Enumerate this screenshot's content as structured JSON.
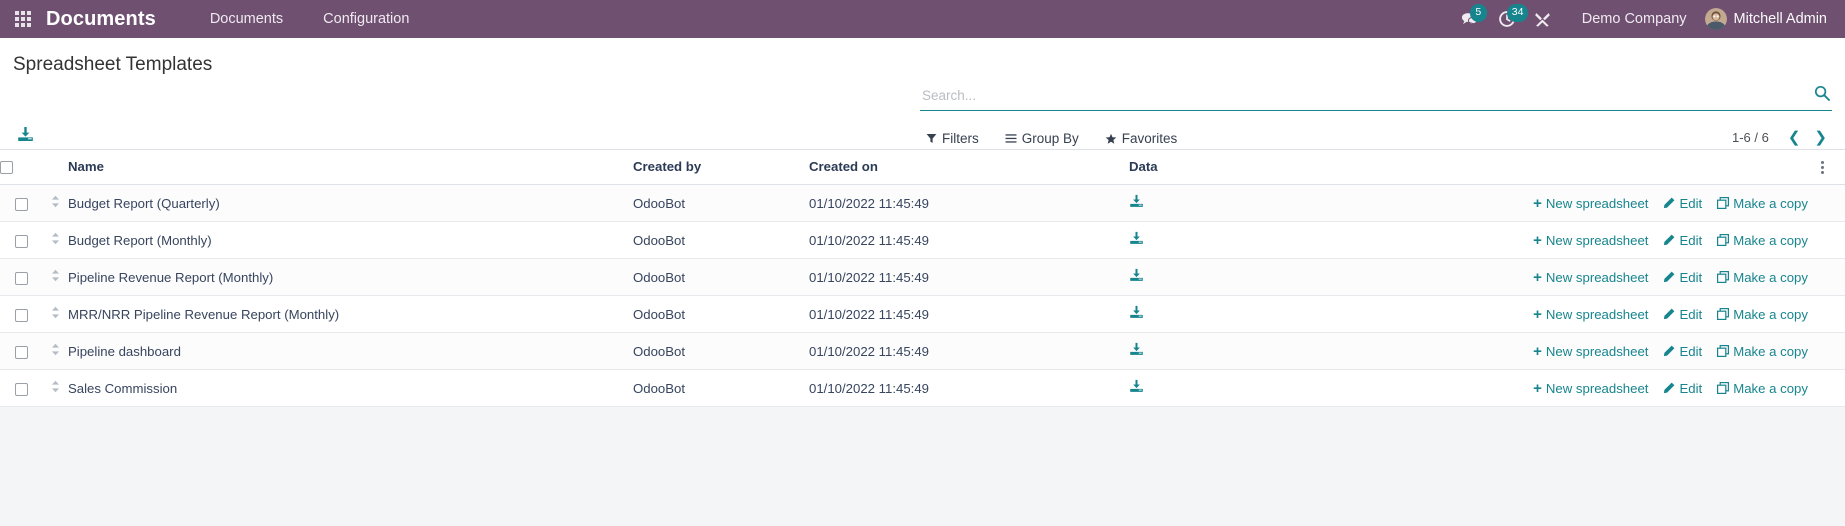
{
  "navbar": {
    "apps_icon": "apps-grid-icon",
    "brand": "Documents",
    "menus": [
      {
        "label": "Documents"
      },
      {
        "label": "Configuration"
      }
    ],
    "messages_icon": "chat-bubble-icon",
    "messages_count": "5",
    "activities_icon": "clock-activity-icon",
    "activities_count": "34",
    "debug_icon": "tools-icon",
    "company": "Demo Company",
    "user": "Mitchell Admin",
    "avatar_icon": "user-avatar"
  },
  "control_panel": {
    "title": "Spreadsheet Templates",
    "upload_icon": "upload-download-icon",
    "search": {
      "placeholder": "Search...",
      "value": "",
      "search_icon": "magnifier-icon"
    },
    "filters": [
      {
        "label": "Filters",
        "icon": "funnel-icon"
      },
      {
        "label": "Group By",
        "icon": "list-lines-icon"
      },
      {
        "label": "Favorites",
        "icon": "star-icon"
      }
    ],
    "pager": {
      "range": "1-6 / 6",
      "prev_icon": "chevron-left-icon",
      "next_icon": "chevron-right-icon"
    }
  },
  "table": {
    "columns": {
      "name": "Name",
      "created_by": "Created by",
      "created_on": "Created on",
      "data": "Data"
    },
    "optional_columns_icon": "vertical-dots-icon",
    "select_all_icon": "checkbox",
    "row_actions": {
      "new_spreadsheet": "New spreadsheet",
      "edit": "Edit",
      "make_a_copy": "Make a copy",
      "new_icon": "plus-icon",
      "edit_icon": "pencil-icon",
      "copy_icon": "copy-icon",
      "data_icon": "download-icon",
      "handle_icon": "drag-handle-icon"
    },
    "rows": [
      {
        "name": "Budget Report (Quarterly)",
        "created_by": "OdooBot",
        "created_on": "01/10/2022 11:45:49"
      },
      {
        "name": "Budget Report (Monthly)",
        "created_by": "OdooBot",
        "created_on": "01/10/2022 11:45:49"
      },
      {
        "name": "Pipeline Revenue Report (Monthly)",
        "created_by": "OdooBot",
        "created_on": "01/10/2022 11:45:49"
      },
      {
        "name": "MRR/NRR Pipeline Revenue Report (Monthly)",
        "created_by": "OdooBot",
        "created_on": "01/10/2022 11:45:49"
      },
      {
        "name": "Pipeline dashboard",
        "created_by": "OdooBot",
        "created_on": "01/10/2022 11:45:49"
      },
      {
        "name": "Sales Commission",
        "created_by": "OdooBot",
        "created_on": "01/10/2022 11:45:49"
      }
    ]
  },
  "colors": {
    "navbar_bg": "#6f5071",
    "accent": "#17858e",
    "page_bg": "#f4f5f7",
    "text": "#37455e"
  }
}
